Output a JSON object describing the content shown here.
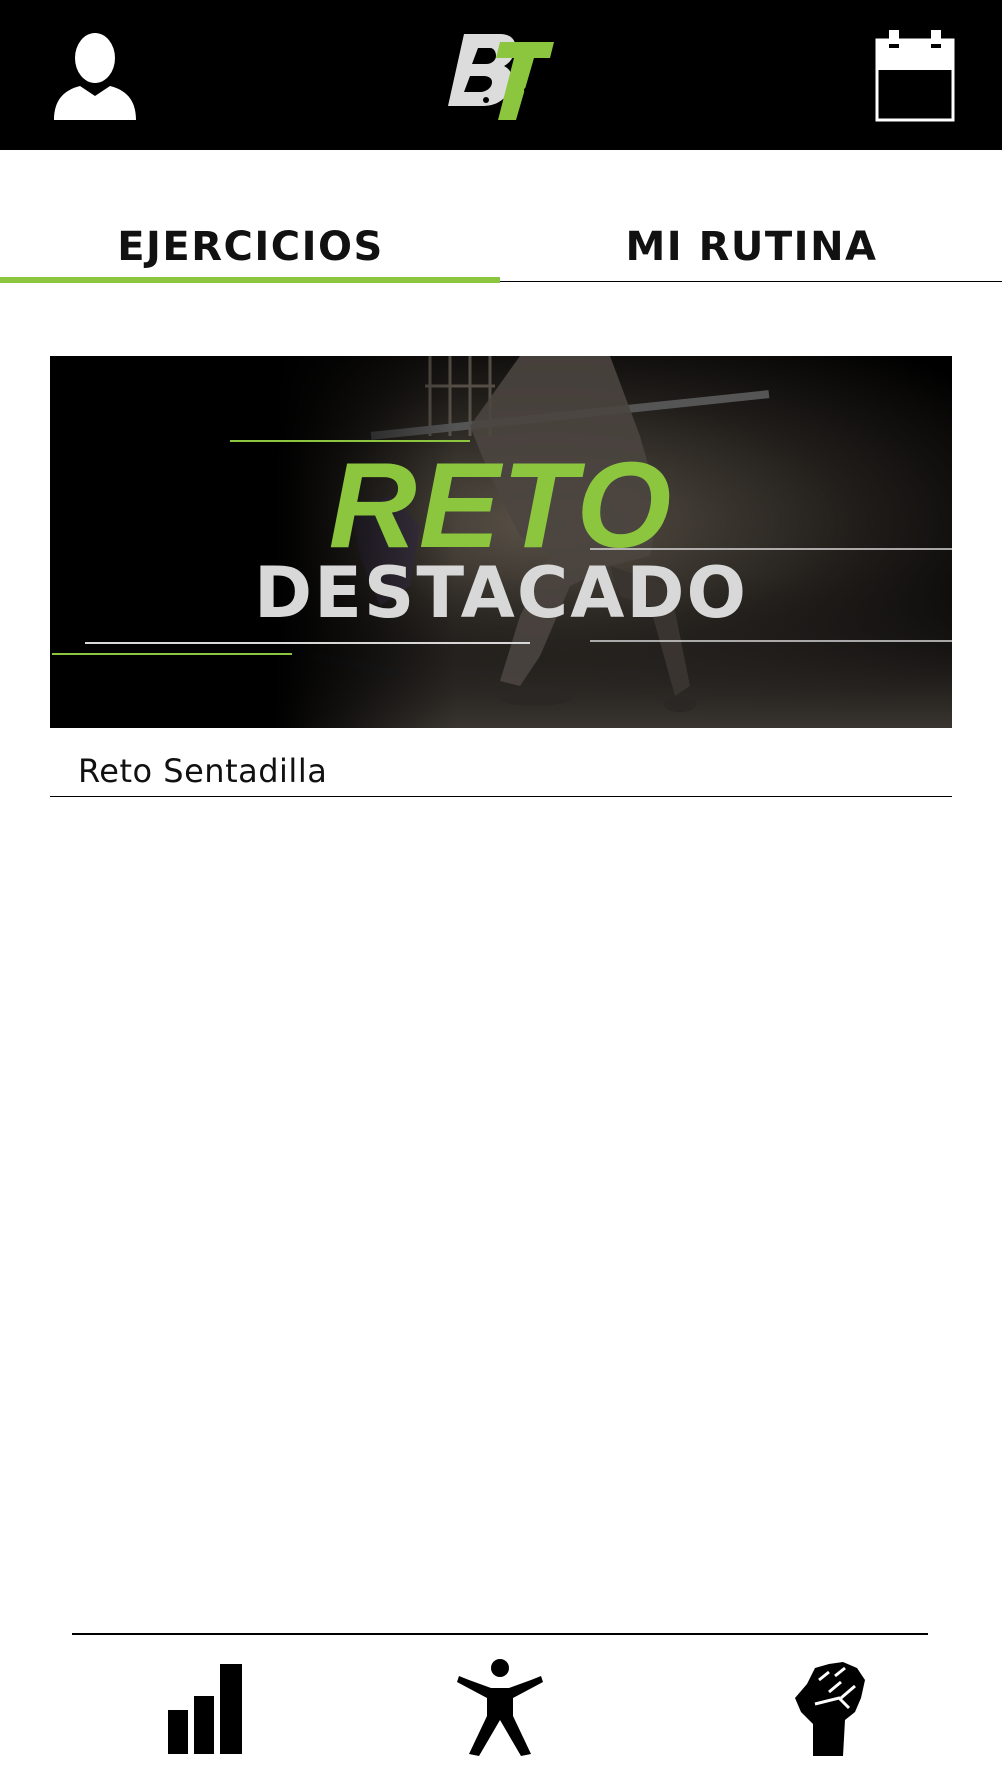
{
  "header": {
    "profile_icon": "user-icon",
    "logo_text": "BT",
    "calendar_icon": "calendar-icon"
  },
  "tabs": [
    {
      "label": "EJERCICIOS",
      "active": true
    },
    {
      "label": "MI RUTINA",
      "active": false
    }
  ],
  "banner": {
    "title_line1": "RETO",
    "title_line2": "DESTACADO"
  },
  "challenges": [
    {
      "label": "Reto Sentadilla"
    }
  ],
  "bottom_nav": [
    {
      "icon": "bar-chart-icon"
    },
    {
      "icon": "person-exercise-icon"
    },
    {
      "icon": "raised-fist-icon"
    }
  ],
  "colors": {
    "accent": "#8cc63f",
    "header_bg": "#000000",
    "banner_subtitle": "#d8d8d8",
    "text": "#111111"
  }
}
